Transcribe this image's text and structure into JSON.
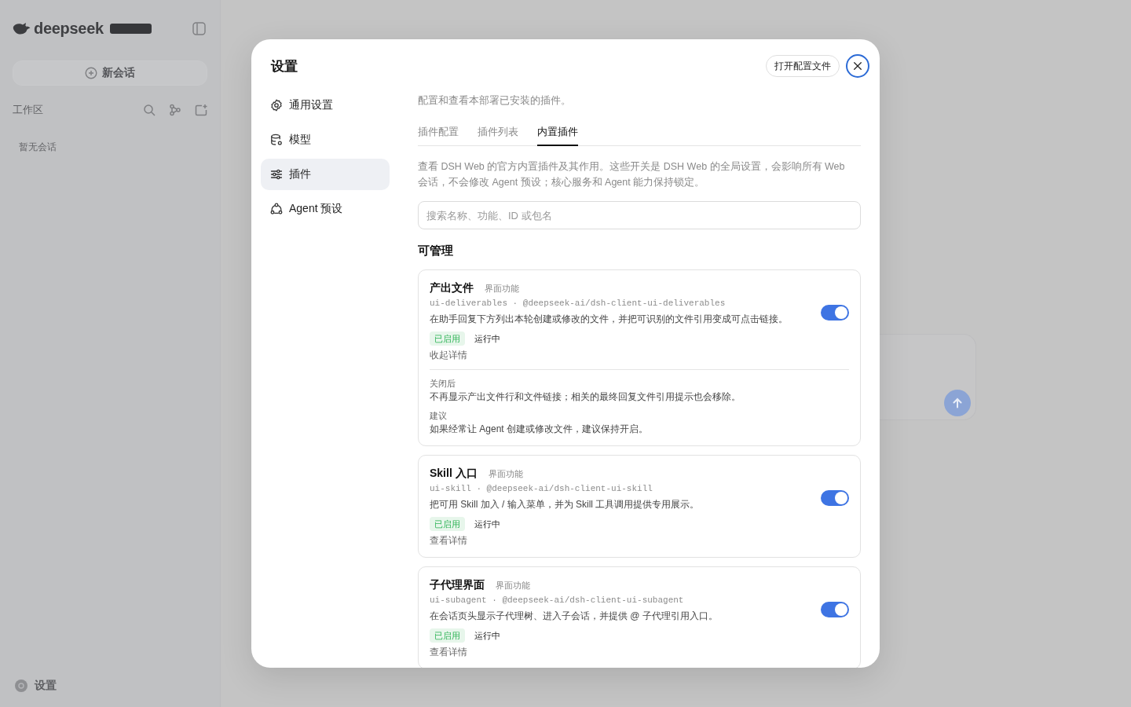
{
  "app": {
    "logo_text": "deepseek",
    "new_chat_button": "新会话",
    "workspace_label": "工作区",
    "empty_sessions": "暂无会话",
    "settings_label": "设置"
  },
  "dialog": {
    "title": "设置",
    "open_config_button": "打开配置文件",
    "nav": [
      {
        "label": "通用设置",
        "selected": false
      },
      {
        "label": "模型",
        "selected": false
      },
      {
        "label": "插件",
        "selected": true
      },
      {
        "label": "Agent 预设",
        "selected": false
      }
    ],
    "description": "配置和查看本部署已安装的插件。",
    "tabs": [
      {
        "label": "插件配置",
        "selected": false
      },
      {
        "label": "插件列表",
        "selected": false
      },
      {
        "label": "内置插件",
        "selected": true
      }
    ],
    "intro": "查看 DSH Web 的官方内置插件及其作用。这些开关是 DSH Web 的全局设置，会影响所有 Web 会话，不会修改 Agent 预设；核心服务和 Agent 能力保持锁定。",
    "search": {
      "placeholder": "搜索名称、功能、ID 或包名"
    },
    "section_title": "可管理",
    "plugins": [
      {
        "name": "产出文件",
        "category": "界面功能",
        "meta": "ui-deliverables · @deepseek-ai/dsh-client-ui-deliverables",
        "description": "在助手回复下方列出本轮创建或修改的文件，并把可识别的文件引用变成可点击链接。",
        "status": "已启用",
        "run_state": "运行中",
        "details_link": "收起详情",
        "on": true,
        "expanded": true,
        "details": [
          {
            "label": "关闭后",
            "text": "不再显示产出文件行和文件链接；相关的最终回复文件引用提示也会移除。"
          },
          {
            "label": "建议",
            "text": "如果经常让 Agent 创建或修改文件，建议保持开启。"
          }
        ]
      },
      {
        "name": "Skill 入口",
        "category": "界面功能",
        "meta": "ui-skill · @deepseek-ai/dsh-client-ui-skill",
        "description": "把可用 Skill 加入 / 输入菜单，并为 Skill 工具调用提供专用展示。",
        "status": "已启用",
        "run_state": "运行中",
        "details_link": "查看详情",
        "on": true,
        "expanded": false
      },
      {
        "name": "子代理界面",
        "category": "界面功能",
        "meta": "ui-subagent · @deepseek-ai/dsh-client-ui-subagent",
        "description": "在会话页头显示子代理树、进入子会话，并提供 @ 子代理引用入口。",
        "status": "已启用",
        "run_state": "运行中",
        "details_link": "查看详情",
        "on": true,
        "expanded": false
      }
    ]
  }
}
